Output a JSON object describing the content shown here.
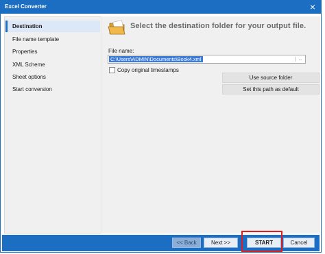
{
  "window": {
    "title": "Excel Converter",
    "close_glyph": "×"
  },
  "sidebar": {
    "items": [
      {
        "label": "Destination",
        "active": true
      },
      {
        "label": "File name template",
        "active": false
      },
      {
        "label": "Properties",
        "active": false
      },
      {
        "label": "XML Scheme",
        "active": false
      },
      {
        "label": "Sheet options",
        "active": false
      },
      {
        "label": "Start conversion",
        "active": false
      }
    ]
  },
  "main": {
    "header": "Select the destination folder for your output file.",
    "header_icon": "folder-icon",
    "file_name_label": "File name:",
    "file_name_value": "C:\\Users\\ADMIN\\Documents\\Book4.xml",
    "browse_glyph": "..",
    "copy_timestamps_label": "Copy original timestamps",
    "copy_timestamps_checked": false,
    "use_source_folder_label": "Use source folder",
    "set_default_label": "Set this path as default"
  },
  "footer": {
    "back_label": "<< Back",
    "next_label": "Next >>",
    "start_label": "START",
    "cancel_label": "Cancel"
  },
  "colors": {
    "accent": "#1b6ec2",
    "highlight": "#d82020",
    "selection": "#3b7ad8"
  }
}
